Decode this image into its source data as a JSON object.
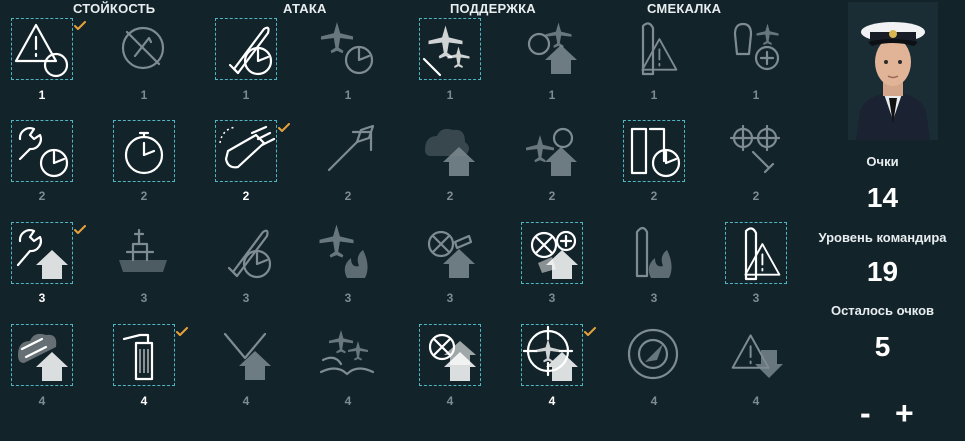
{
  "categories": [
    "СТОЙКОСТЬ",
    "АТАКА",
    "ПОДДЕРЖКА",
    "СМЕКАЛКА"
  ],
  "rows": [
    {
      "cost": "1",
      "skills": [
        {
          "icon": "warning-timer-icon",
          "selected": true,
          "learned": true
        },
        {
          "icon": "crossed-compass-icon",
          "selected": false,
          "learned": false
        },
        {
          "icon": "torpedo-timer-icon",
          "selected": true,
          "learned": false
        },
        {
          "icon": "plane-timer-icon",
          "selected": false,
          "learned": false
        },
        {
          "icon": "fighter-planes-icon",
          "selected": true,
          "learned": false
        },
        {
          "icon": "plane-upgrade-icon",
          "selected": false,
          "learned": false
        },
        {
          "icon": "torpedo-warning-icon",
          "selected": false,
          "learned": false
        },
        {
          "icon": "bomb-plane-plus-icon",
          "selected": false,
          "learned": false
        }
      ]
    },
    {
      "cost": "2",
      "skills": [
        {
          "icon": "wrench-timer-icon",
          "selected": true,
          "learned": false
        },
        {
          "icon": "stopwatch-icon",
          "selected": true,
          "learned": false
        },
        {
          "icon": "turret-icon",
          "selected": true,
          "learned": true
        },
        {
          "icon": "shell-arrow-icon",
          "selected": false,
          "learned": false
        },
        {
          "icon": "smoke-upgrade-icon",
          "selected": false,
          "learned": false
        },
        {
          "icon": "plane-target-upgrade-icon",
          "selected": false,
          "learned": false
        },
        {
          "icon": "torpedo-reload-timer-icon",
          "selected": true,
          "learned": false
        },
        {
          "icon": "gear-wrench-icon",
          "selected": false,
          "learned": false
        }
      ]
    },
    {
      "cost": "3",
      "skills": [
        {
          "icon": "wrench-upgrade-icon",
          "selected": true,
          "learned": true
        },
        {
          "icon": "battleship-icon",
          "selected": false,
          "learned": false
        },
        {
          "icon": "torpedo-timer-icon",
          "selected": false,
          "learned": false
        },
        {
          "icon": "plane-fire-icon",
          "selected": false,
          "learned": false
        },
        {
          "icon": "target-shell-upgrade-icon",
          "selected": false,
          "learned": false
        },
        {
          "icon": "target-plus-upgrade-icon",
          "selected": true,
          "learned": false
        },
        {
          "icon": "torpedo-fire-icon",
          "selected": false,
          "learned": false
        },
        {
          "icon": "torpedo-warning-icon",
          "selected": true,
          "learned": false
        }
      ]
    },
    {
      "cost": "4",
      "skills": [
        {
          "icon": "shells-upgrade-icon",
          "selected": true,
          "learned": false
        },
        {
          "icon": "canister-icon",
          "selected": true,
          "learned": true
        },
        {
          "icon": "crossed-torpedo-upgrade-icon",
          "selected": false,
          "learned": false
        },
        {
          "icon": "planes-ship-icon",
          "selected": false,
          "learned": false
        },
        {
          "icon": "double-upgrade-icon",
          "selected": true,
          "learned": false
        },
        {
          "icon": "crosshair-plane-upgrade-icon",
          "selected": true,
          "learned": true
        },
        {
          "icon": "radar-icon",
          "selected": false,
          "learned": false
        },
        {
          "icon": "warning-down-icon",
          "selected": false,
          "learned": false
        }
      ]
    }
  ],
  "panel": {
    "points_label": "Очки",
    "points_value": "14",
    "level_label": "Уровень командира",
    "level_value": "19",
    "remaining_label": "Осталось очков",
    "remaining_value": "5",
    "minus": "-",
    "plus": "+"
  },
  "colors": {
    "accent": "#4fb6c4",
    "check": "#e8a23a",
    "active_icon": "#ffffff",
    "inactive_icon": "#7e8c92",
    "background": "#13232a"
  }
}
